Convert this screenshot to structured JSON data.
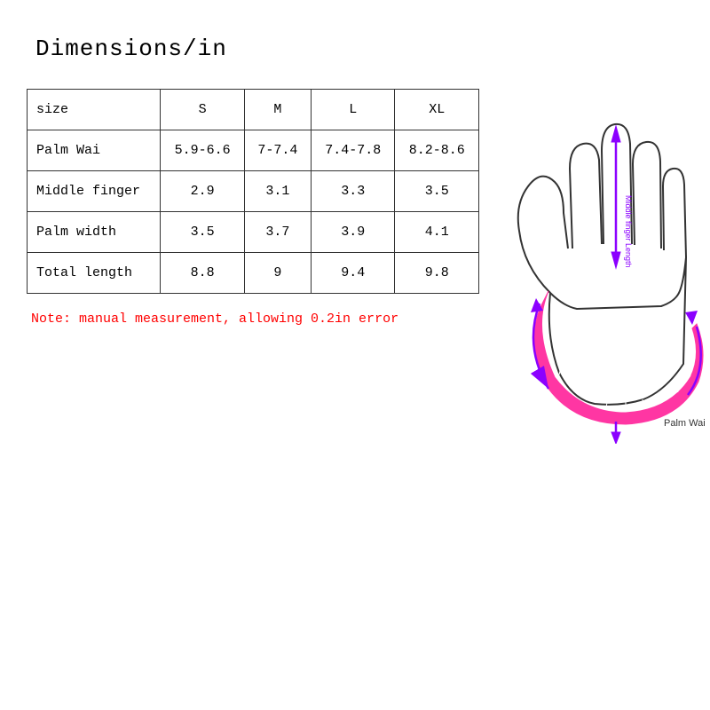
{
  "title": "Dimensions/in",
  "table": {
    "headers": [
      "size",
      "S",
      "M",
      "L",
      "XL"
    ],
    "rows": [
      [
        "Palm Wai",
        "5.9-6.6",
        "7-7.4",
        "7.4-7.8",
        "8.2-8.6"
      ],
      [
        "Middle finger",
        "2.9",
        "3.1",
        "3.3",
        "3.5"
      ],
      [
        "Palm width",
        "3.5",
        "3.7",
        "3.9",
        "4.1"
      ],
      [
        "Total length",
        "8.8",
        "9",
        "9.4",
        "9.8"
      ]
    ]
  },
  "note": "Note: manual measurement, allowing 0.2in error",
  "diagram": {
    "palm_wai_label": "Palm Wai",
    "middle_finger_label": "Middle finger Length"
  }
}
